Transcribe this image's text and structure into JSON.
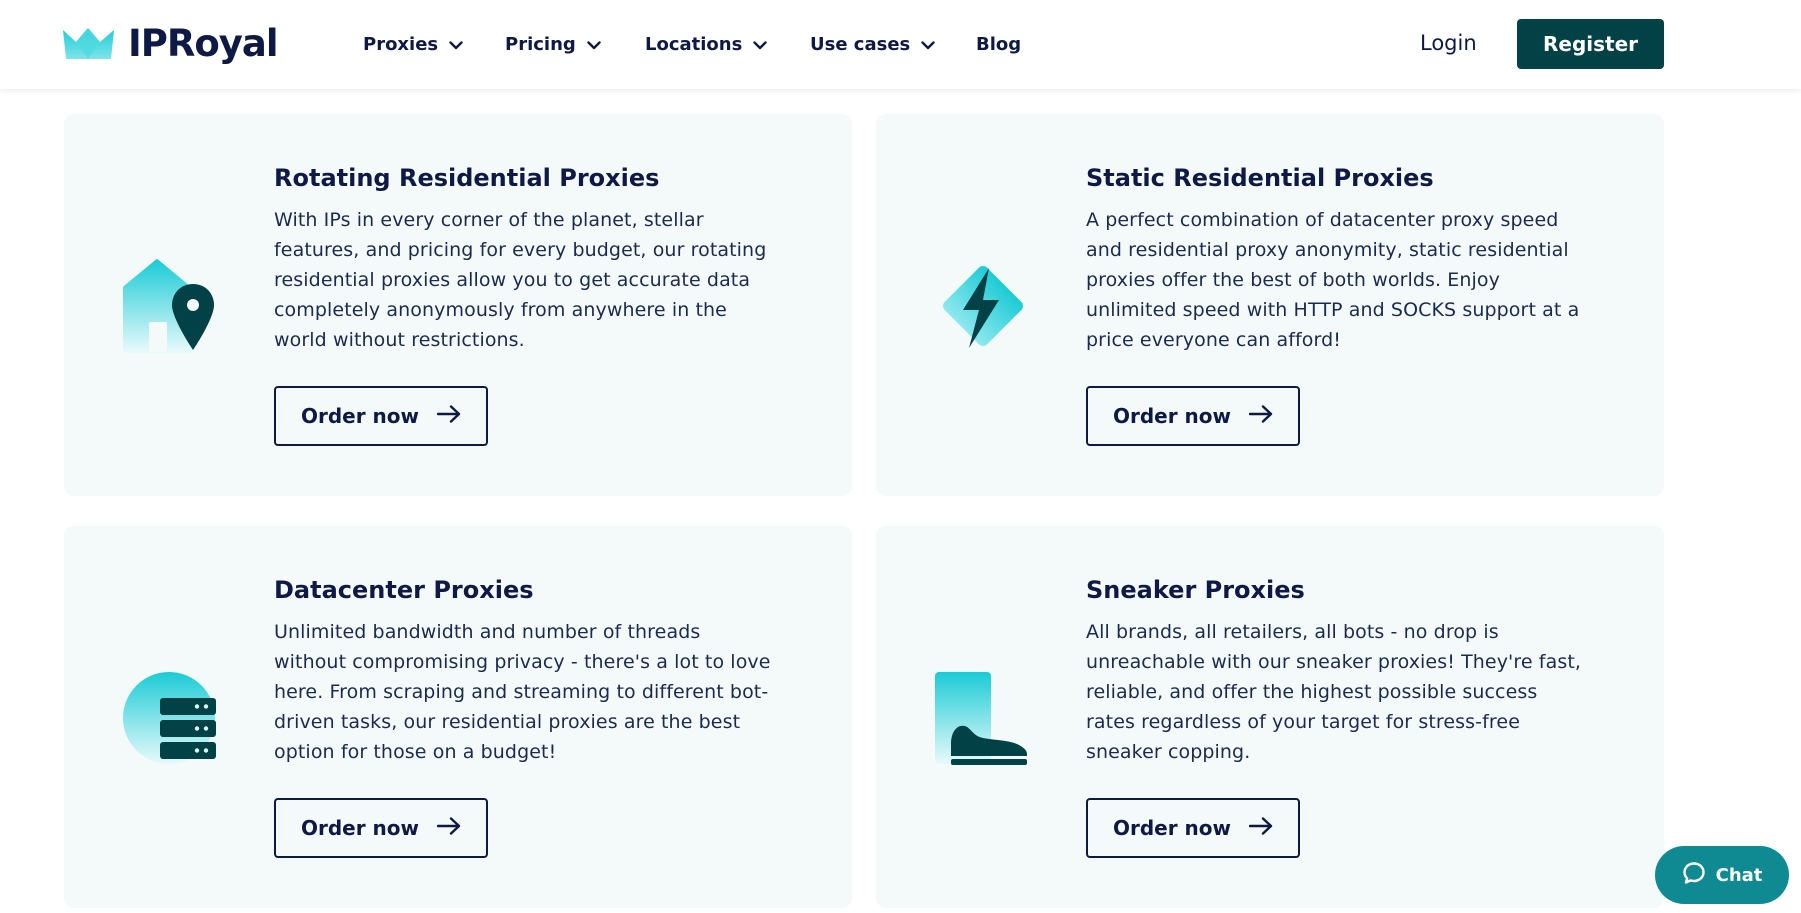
{
  "header": {
    "logo_text": "IPRoyal",
    "nav": [
      {
        "label": "Proxies",
        "has_dropdown": true
      },
      {
        "label": "Pricing",
        "has_dropdown": true
      },
      {
        "label": "Locations",
        "has_dropdown": true
      },
      {
        "label": "Use cases",
        "has_dropdown": true
      },
      {
        "label": "Blog",
        "has_dropdown": false
      }
    ],
    "login_label": "Login",
    "register_label": "Register"
  },
  "cards": [
    {
      "title": "Rotating Residential Proxies",
      "description": "With IPs in every corner of the planet, stellar\nfeatures, and pricing for every budget, our rotating\nresidential proxies allow you to get accurate data\ncompletely anonymously from anywhere in the\nworld without restrictions.",
      "button_label": "Order now",
      "icon": "house-location-icon"
    },
    {
      "title": "Static Residential Proxies",
      "description": "A perfect combination of datacenter proxy speed\nand residential proxy anonymity, static residential\nproxies offer the best of both worlds. Enjoy\nunlimited speed with HTTP and SOCKS support at a\nprice everyone can afford!",
      "button_label": "Order now",
      "icon": "lightning-bolt-icon"
    },
    {
      "title": "Datacenter Proxies",
      "description": "Unlimited bandwidth and number of threads\nwithout compromising privacy - there's a lot to love\nhere. From scraping and streaming to different bot-\ndriven tasks, our residential proxies are the best\noption for those on a budget!",
      "button_label": "Order now",
      "icon": "server-stack-icon"
    },
    {
      "title": "Sneaker Proxies",
      "description": "All brands, all retailers, all bots - no drop is\nunreachable with our sneaker proxies! They're fast,\nreliable, and offer the highest possible success\nrates regardless of your target for stress-free\nsneaker copping.",
      "button_label": "Order now",
      "icon": "sneaker-icon"
    }
  ],
  "chat": {
    "label": "Chat",
    "icon": "chat-bubble-icon"
  },
  "colors": {
    "primary_dark": "#024146",
    "text_navy": "#0e1a45",
    "accent_cyan": "#1ccbd6",
    "card_bg": "#f4f9f9",
    "chat_bg": "#0f8a93"
  }
}
